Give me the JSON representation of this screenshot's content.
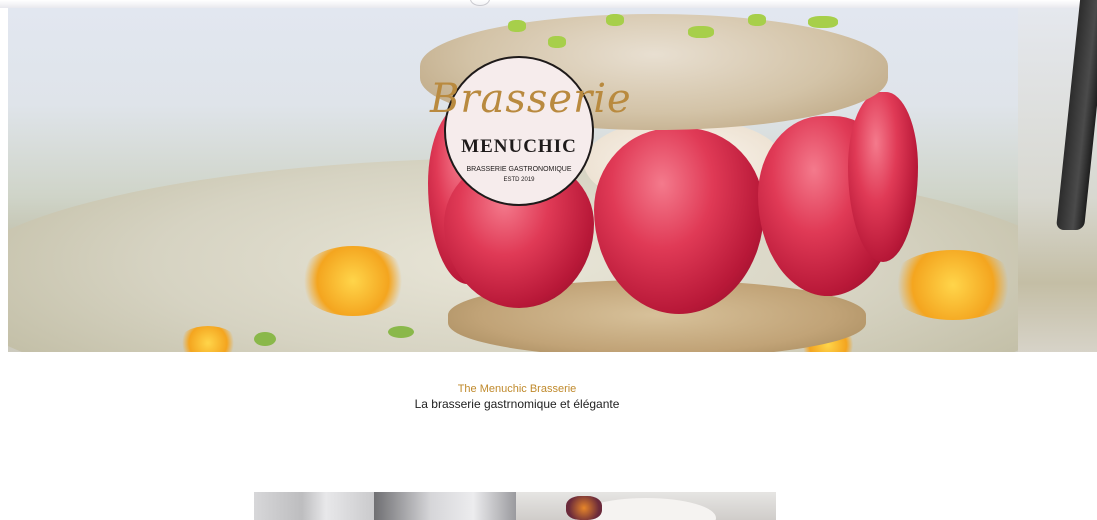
{
  "brand": {
    "script": "Brasserie",
    "name": "MENUCHIC",
    "tagline": "BRASSERIE GASTRONOMIQUE",
    "established": "ESTD 2019"
  },
  "intro": {
    "title": "The Menuchic Brasserie",
    "subtitle": "La brasserie gastrnomique et élégante"
  },
  "colors": {
    "accent_gold": "#c08a2c",
    "text_dark": "#222222",
    "logo_background": "#f6ecec"
  }
}
